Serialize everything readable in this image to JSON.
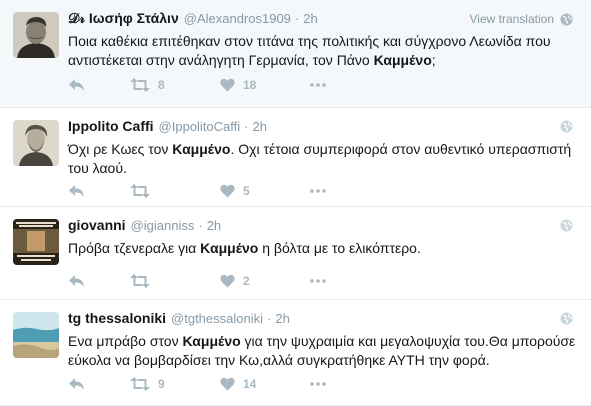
{
  "tweets": [
    {
      "fullname": "𝒟𝓇 Ιωσήφ Στάλιν",
      "username": "@Alexandros1909",
      "time": "2h",
      "view_translation": "View translation",
      "text_pre": "Ποια καθέκια επιτέθηκαν στον τιτάνα της πολιτικής και σύγχρονο Λεωνίδα που αντιστέκεται στην ανάληγητη Γερμανία, τον Πάνο ",
      "text_bold": "Καμμένο",
      "text_post": ";",
      "retweets": "8",
      "likes": "18"
    },
    {
      "fullname": "Ippolito Caffi",
      "username": "@IppolitoCaffi",
      "time": "2h",
      "text_pre": "Όχι ρε Κωες τον ",
      "text_bold": "Καμμένο",
      "text_post": ". Οχι τέτοια συμπεριφορά στον αυθεντικό υπερασπιστή του λαού.",
      "retweets": "",
      "likes": "5"
    },
    {
      "fullname": "giovanni",
      "username": "@igianniss",
      "time": "2h",
      "text_pre": "Πρόβα τζενεραλε για ",
      "text_bold": "Καμμένο",
      "text_post": " η βόλτα με το ελικόπτερο.",
      "retweets": "",
      "likes": "2"
    },
    {
      "fullname": "tg thessaloniki",
      "username": "@tgthessaloniki",
      "time": "2h",
      "text_pre": "Ενα μπράβο στον ",
      "text_bold": "Καμμένο",
      "text_post": " για την ψυχραιμία και μεγαλοψυχία του.Θα μπορούσε εύκολα να βομβαρδίσει την Κω,αλλά συγκρατήθηκε ΑΥΤΗ την φορά.",
      "retweets": "9",
      "likes": "14"
    }
  ],
  "icons": {
    "reply": "reply-icon",
    "retweet": "retweet-icon",
    "like": "heart-icon",
    "more": "more-icon",
    "globe": "globe-icon"
  },
  "colors": {
    "action_icon": "#aab8c2",
    "muted_text": "#8899a6",
    "highlight_bg": "#f5f8fa"
  }
}
